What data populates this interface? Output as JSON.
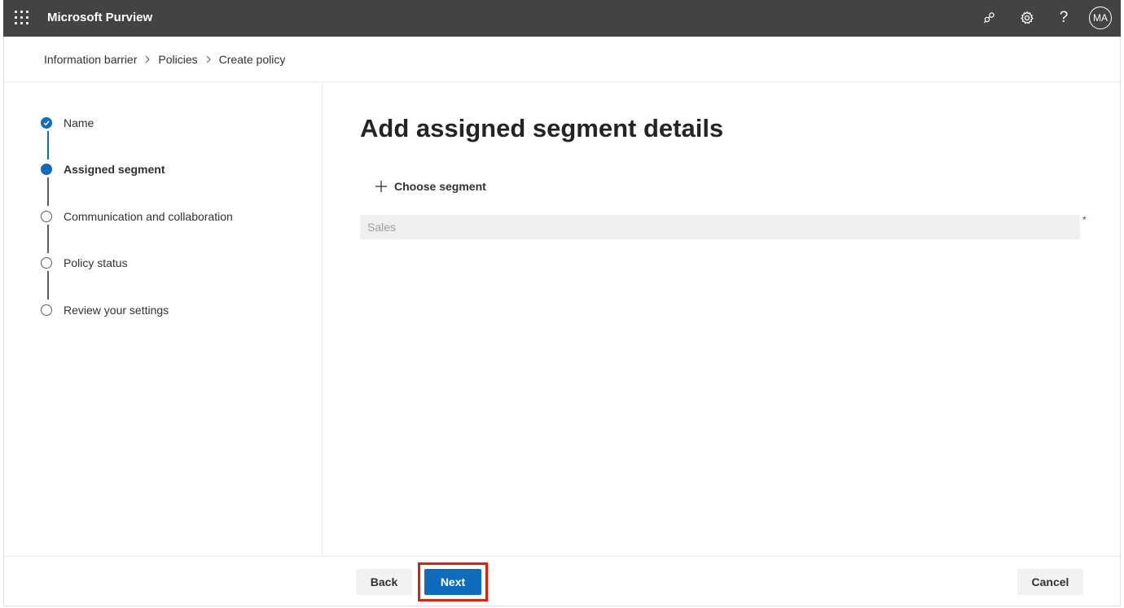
{
  "app": {
    "title": "Microsoft Purview"
  },
  "topbar": {
    "icons": [
      "app-launcher-icon",
      "connections-icon",
      "settings-gear-icon",
      "help-icon"
    ],
    "help_glyph": "?",
    "avatar_initials": "MA"
  },
  "breadcrumb": {
    "items": [
      "Information barrier",
      "Policies",
      "Create policy"
    ]
  },
  "steps": [
    {
      "label": "Name",
      "state": "completed"
    },
    {
      "label": "Assigned segment",
      "state": "current"
    },
    {
      "label": "Communication and collaboration",
      "state": "pending"
    },
    {
      "label": "Policy status",
      "state": "pending"
    },
    {
      "label": "Review your settings",
      "state": "pending"
    }
  ],
  "main": {
    "title": "Add assigned segment details",
    "choose_segment_label": "Choose segment",
    "segment_value": "Sales",
    "required_marker": "*"
  },
  "footer": {
    "back_label": "Back",
    "next_label": "Next",
    "cancel_label": "Cancel"
  },
  "colors": {
    "topbar_bg": "#434343",
    "accent": "#0f6cbd",
    "highlight_box": "#d9210e",
    "required": "#a4262c"
  }
}
